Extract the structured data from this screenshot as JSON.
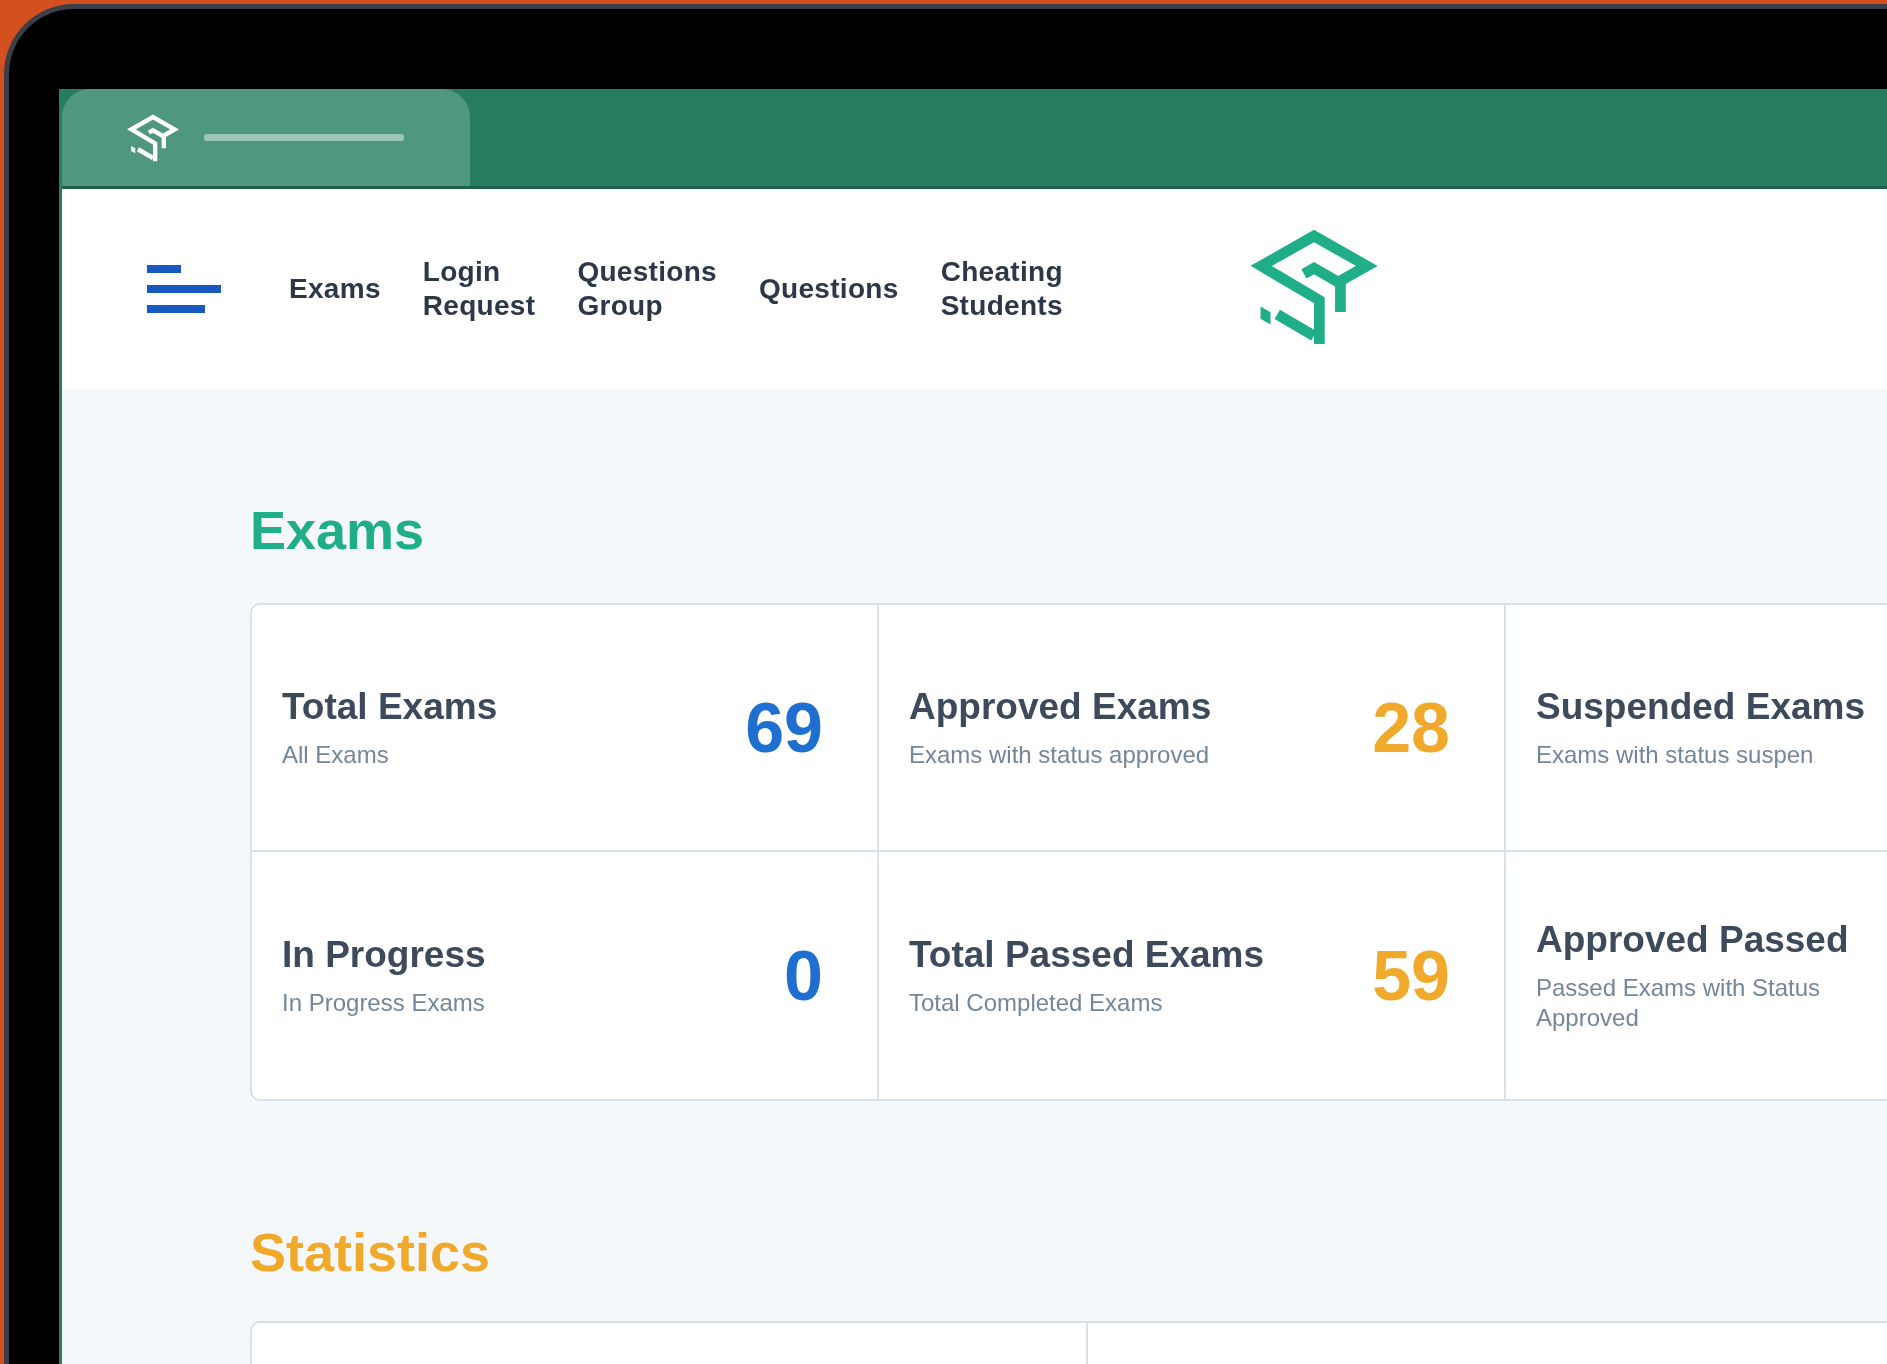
{
  "nav": {
    "items": [
      {
        "label": "Exams"
      },
      {
        "label": "Login\nRequest"
      },
      {
        "label": "Questions\nGroup"
      },
      {
        "label": "Questions"
      },
      {
        "label": "Cheating\nStudents"
      }
    ]
  },
  "exams": {
    "title": "Exams",
    "cards": [
      {
        "title": "Total Exams",
        "subtitle": "All Exams",
        "value": "69",
        "color": "#1f6fd1"
      },
      {
        "title": "Approved Exams",
        "subtitle": "Exams with status approved",
        "value": "28",
        "color": "#f0a92a"
      },
      {
        "title": "Suspended Exams",
        "subtitle": "Exams with status suspen"
      },
      {
        "title": "In Progress",
        "subtitle": "In Progress Exams",
        "value": "0",
        "color": "#1f6fd1"
      },
      {
        "title": "Total Passed Exams",
        "subtitle": "Total Completed Exams",
        "value": "59",
        "color": "#f0a92a"
      },
      {
        "title": "Approved Passed",
        "subtitle": "Passed Exams with Status Approved"
      }
    ]
  },
  "statistics": {
    "title": "Statistics"
  }
}
